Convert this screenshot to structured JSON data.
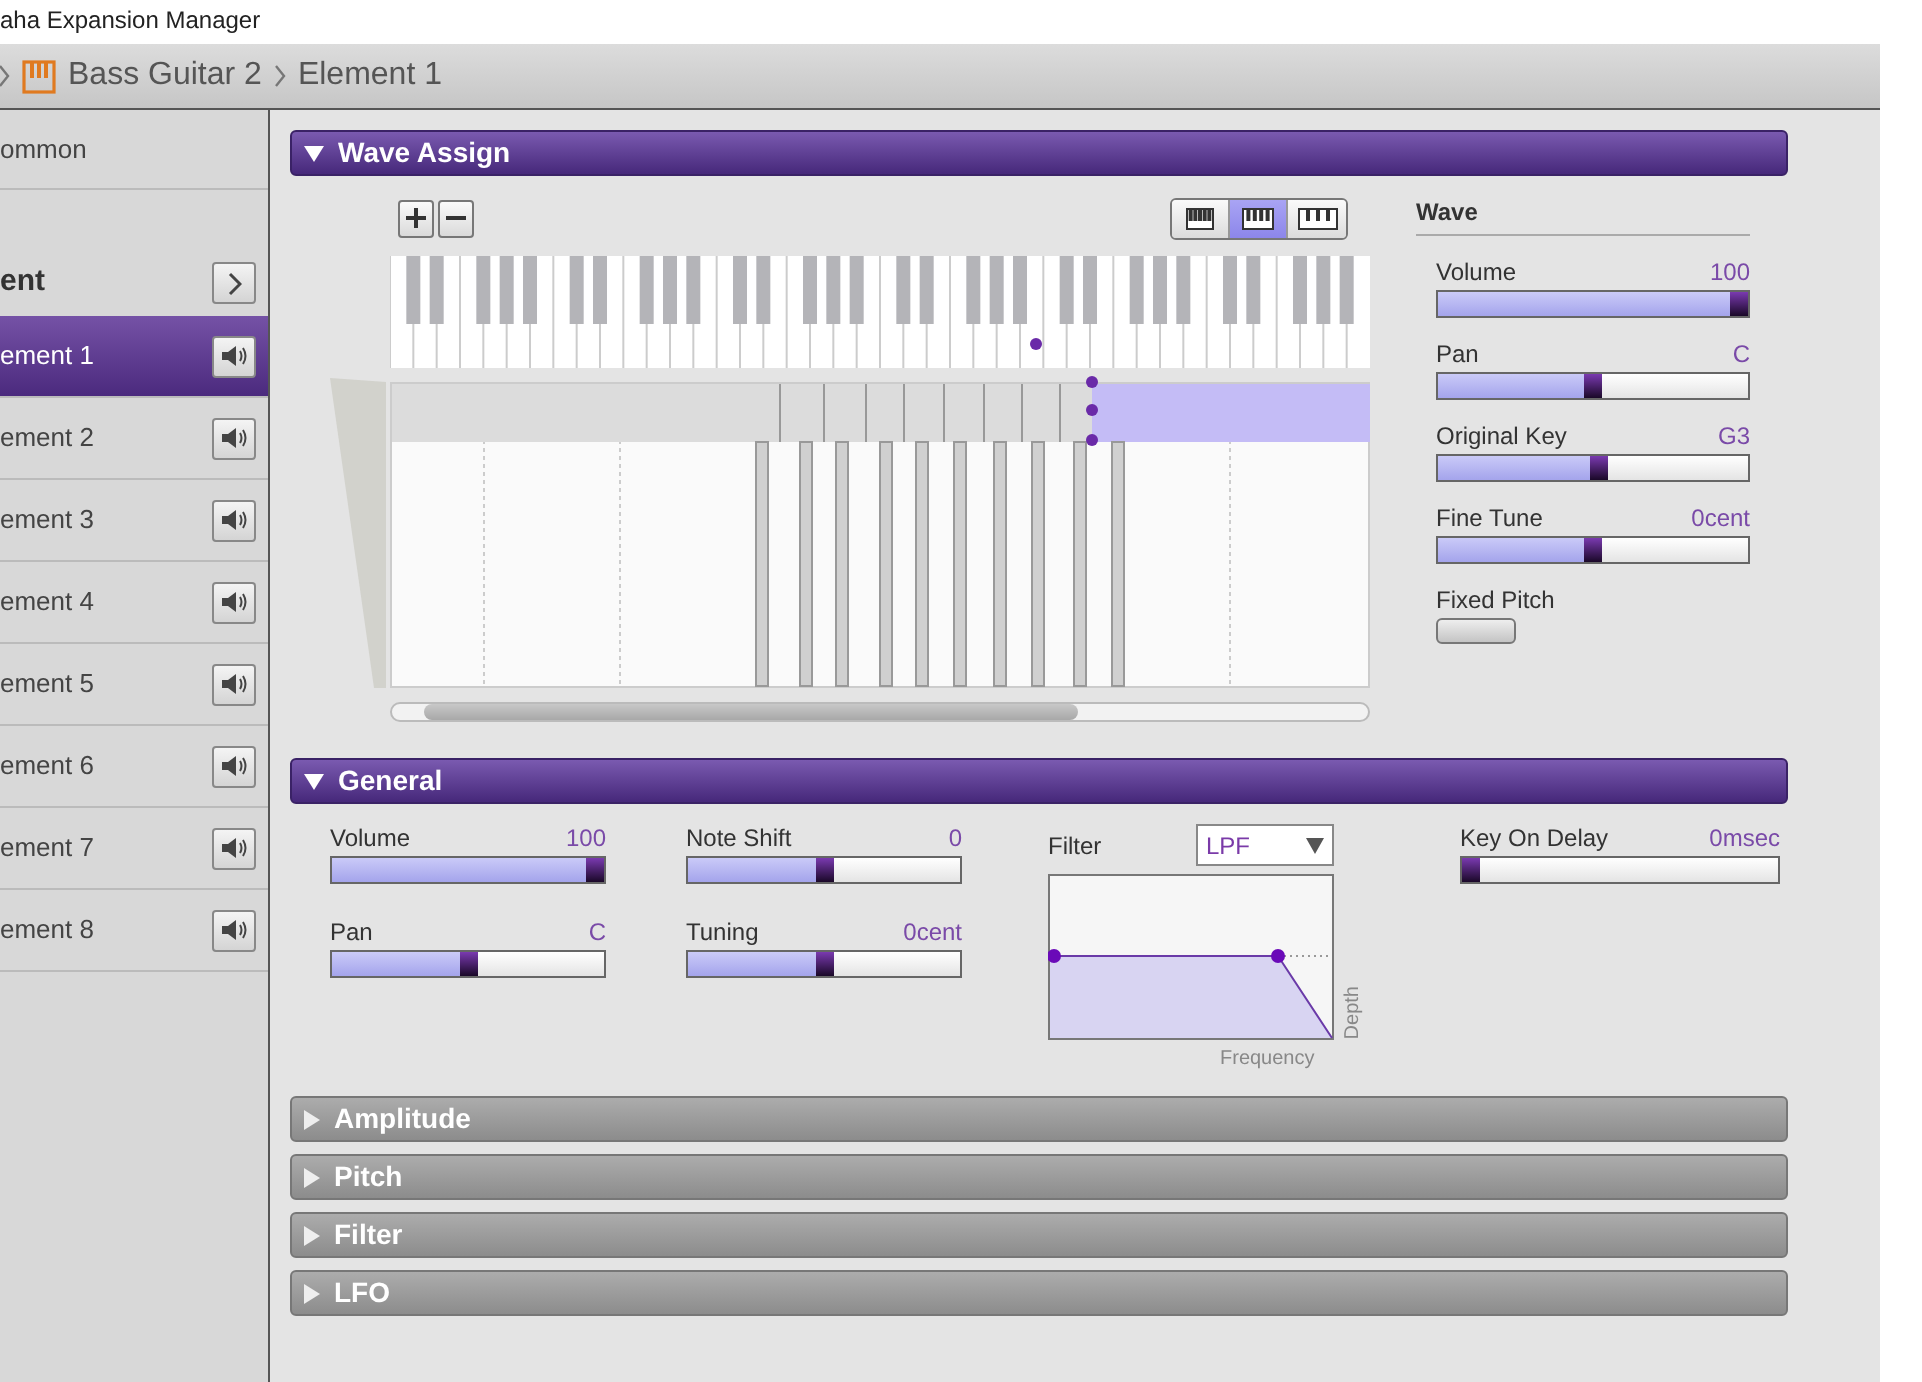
{
  "window": {
    "title": "aha Expansion Manager"
  },
  "breadcrumb": [
    "Bass Guitar 2",
    "Element 1"
  ],
  "sidebar": {
    "common": "ommon",
    "element_header": "ent",
    "elements": [
      {
        "label": "ement 1",
        "selected": true
      },
      {
        "label": "ement 2",
        "selected": false
      },
      {
        "label": "ement 3",
        "selected": false
      },
      {
        "label": "ement 4",
        "selected": false
      },
      {
        "label": "ement 5",
        "selected": false
      },
      {
        "label": "ement 6",
        "selected": false
      },
      {
        "label": "ement 7",
        "selected": false
      },
      {
        "label": "ement 8",
        "selected": false
      }
    ]
  },
  "wave_assign": {
    "title": "Wave Assign",
    "expanded": true,
    "zoom_buttons": [
      {
        "selected": false
      },
      {
        "selected": true
      },
      {
        "selected": false
      }
    ],
    "wave": {
      "title": "Wave",
      "sliders": [
        {
          "label": "Volume",
          "reading": "100",
          "level": 1
        },
        {
          "label": "Pan",
          "reading": "C",
          "level": 0.5
        },
        {
          "label": "Original Key",
          "reading": "G3",
          "level": 0.52
        },
        {
          "label": "Fine Tune",
          "reading": "0cent",
          "level": 0.5
        }
      ],
      "fixed_pitch": {
        "label": "Fixed Pitch",
        "on": false
      }
    }
  },
  "general": {
    "title": "General",
    "expanded": true,
    "sliders": [
      {
        "label": "Volume",
        "reading": "100",
        "level": 1
      },
      {
        "label": "Note Shift",
        "reading": "0",
        "level": 0.5
      },
      {
        "label": "Pan",
        "reading": "C",
        "level": 0.5
      },
      {
        "label": "Tuning",
        "reading": "0cent",
        "level": 0.5
      }
    ],
    "filter": {
      "label": "Filter",
      "type": "LPF",
      "xlabel": "Frequency",
      "ylabel": "Depth"
    },
    "key_on_delay": {
      "label": "Key On Delay",
      "reading": "0msec",
      "level": 0
    }
  },
  "sections": [
    {
      "title": "Amplitude",
      "expanded": false
    },
    {
      "title": "Pitch",
      "expanded": false
    },
    {
      "title": "Filter",
      "expanded": false
    },
    {
      "title": "LFO",
      "expanded": false
    }
  ]
}
